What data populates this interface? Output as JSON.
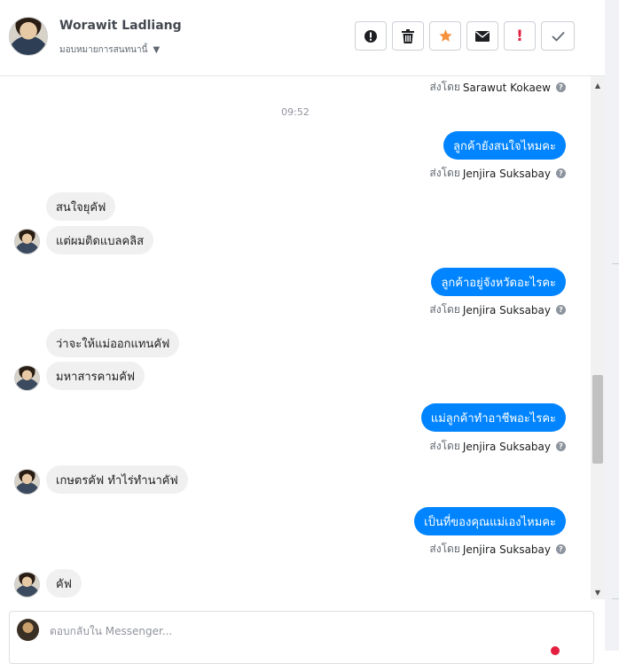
{
  "header": {
    "user_name": "Worawit Ladliang",
    "assign_label": "มอบหมายการสนทนานี้",
    "toolbar": [
      {
        "name": "alert-icon",
        "glyph": "●!",
        "color": "#1c1e21"
      },
      {
        "name": "trash-icon",
        "glyph": "🗑",
        "color": "#1c1e21"
      },
      {
        "name": "star-icon",
        "glyph": "★",
        "color": "#f7923b"
      },
      {
        "name": "mail-icon",
        "glyph": "✉",
        "color": "#1c1e21"
      },
      {
        "name": "exclamation-icon",
        "glyph": "!",
        "color": "#e41e3f"
      },
      {
        "name": "check-icon",
        "glyph": "✓",
        "color": "#606770"
      }
    ]
  },
  "conversation": {
    "sent_by_label": "ส่งโดย",
    "timestamp": "09:52",
    "sender_1": "Sarawut Kokaew",
    "sender_2": "Jenjira Suksabay",
    "outgoing": [
      "ลูกค้ายังสนใจไหมคะ",
      "ลูกค้าอยู่จังหวัดอะไรคะ",
      "แม่ลูกค้าทำอาชีพอะไรคะ",
      "เป็นที่ของคุณแม่เองไหมคะ"
    ],
    "incoming": [
      "สนใจยุคัฟ",
      "แต่ผมติดแบลคลิส",
      "ว่าจะให้แม่ออกแทนคัฟ",
      "มหาสารคามคัฟ",
      "เกษตรคัฟ ทำไร่ทำนาคัฟ",
      "คัฟ"
    ]
  },
  "composer": {
    "placeholder": "ตอบกลับใน Messenger..."
  },
  "colors": {
    "outgoing_bubble": "#0084ff",
    "incoming_bubble": "#f1f0f0",
    "accent_star": "#f7923b",
    "alert_red": "#e41e3f"
  }
}
